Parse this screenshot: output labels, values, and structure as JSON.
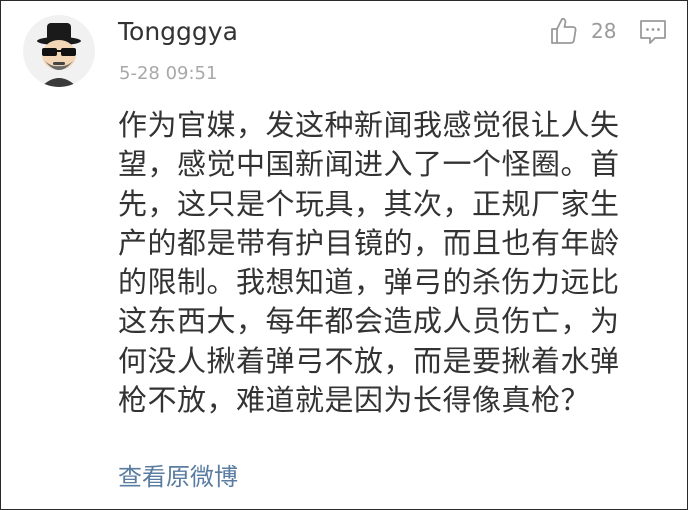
{
  "user": {
    "name": "Tongggya"
  },
  "meta": {
    "timestamp": "5-28 09:51"
  },
  "actions": {
    "like_count": "28"
  },
  "comment": {
    "lines": [
      "作为官媒，发这种新闻我感觉很让人失",
      "望，感觉中国新闻进入了一个怪圈。首",
      "先，这只是个玩具，其次，正规厂家生",
      "产的都是带有护目镜的，而且也有年龄",
      "的限制。我想知道，弹弓的杀伤力远比",
      "这东西大，每年都会造成人员伤亡，为",
      "何没人揪着弹弓不放，而是要揪着水弹",
      "枪不放，难道就是因为长得像真枪？"
    ]
  },
  "link": {
    "view_original": "查看原微博"
  },
  "colors": {
    "link": "#5a7ca0",
    "meta": "#a8a8a8",
    "text": "#333333"
  }
}
